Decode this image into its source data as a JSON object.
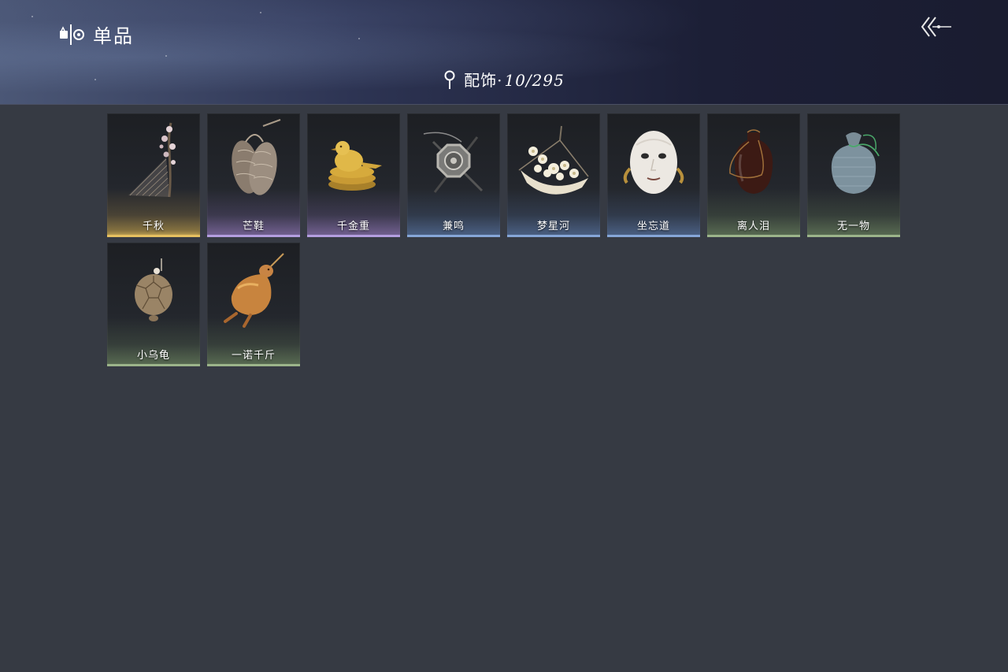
{
  "header": {
    "title": "单品",
    "category": "配饰",
    "separator": "·",
    "count": "10/295"
  },
  "icons": {
    "title": "collection-icon",
    "back": "back-arrow-icon",
    "location": "pin-icon"
  },
  "items": [
    {
      "name": "千秋",
      "quality": "gold",
      "icon": "plum-blossom-fan-icon"
    },
    {
      "name": "芒鞋",
      "quality": "purple",
      "icon": "straw-sandals-icon"
    },
    {
      "name": "千金重",
      "quality": "purple",
      "icon": "golden-bird-icon"
    },
    {
      "name": "兼鸣",
      "quality": "blue",
      "icon": "octagonal-plaque-icon"
    },
    {
      "name": "梦星河",
      "quality": "blue",
      "icon": "flower-boat-icon"
    },
    {
      "name": "坐忘道",
      "quality": "blue",
      "icon": "white-mask-icon"
    },
    {
      "name": "离人泪",
      "quality": "green",
      "icon": "dark-jar-icon"
    },
    {
      "name": "无一物",
      "quality": "green",
      "icon": "cloth-pouch-icon"
    },
    {
      "name": "小乌龟",
      "quality": "green",
      "icon": "turtle-icon"
    },
    {
      "name": "一诺千斤",
      "quality": "green",
      "icon": "roast-duck-icon"
    }
  ],
  "colors": {
    "background": "#363a43",
    "gold": "#e6c060",
    "purple": "#b49ee0",
    "blue": "#86a6d8",
    "green": "#9cb48a"
  }
}
